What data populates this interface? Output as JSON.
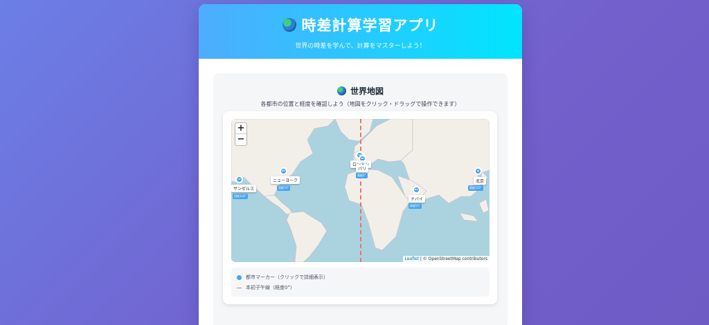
{
  "header": {
    "title": "時差計算学習アプリ",
    "subtitle": "世界の時差を学んで、計算をマスターしよう！"
  },
  "section": {
    "title": "世界地図",
    "description": "各都市の位置と経度を確認しよう（地図をクリック・ドラッグで操作できます）"
  },
  "map": {
    "zoom_in": "+",
    "zoom_out": "−",
    "attribution_leaflet": "Leaflet",
    "attribution_rest": " | © OpenStreetMap contributors",
    "markers": [
      {
        "code": "LA",
        "name": "サンゼルス",
        "offset": "西経118°"
      },
      {
        "code": "NY",
        "name": "ニューヨーク",
        "offset": "西経74°"
      },
      {
        "code": "LN",
        "name": "ロンドン",
        "offset": "経度0°"
      },
      {
        "code": "PA",
        "name": "パリ",
        "offset": "東経2°"
      },
      {
        "code": "DU",
        "name": "ドバイ",
        "offset": "東経55°"
      },
      {
        "code": "BJ",
        "name": "北京",
        "offset": "東経116°"
      }
    ]
  },
  "legend": {
    "city_marker": "都市マーカー（クリックで詳細表示）",
    "prime_meridian": "本初子午線（経度0°）"
  },
  "colors": {
    "header_start": "#4facfe",
    "header_end": "#00e5fe",
    "marker": "#4aa3f0",
    "meridian": "#ef6f6c",
    "ocean": "#aad3df",
    "land": "#f2efe9"
  }
}
